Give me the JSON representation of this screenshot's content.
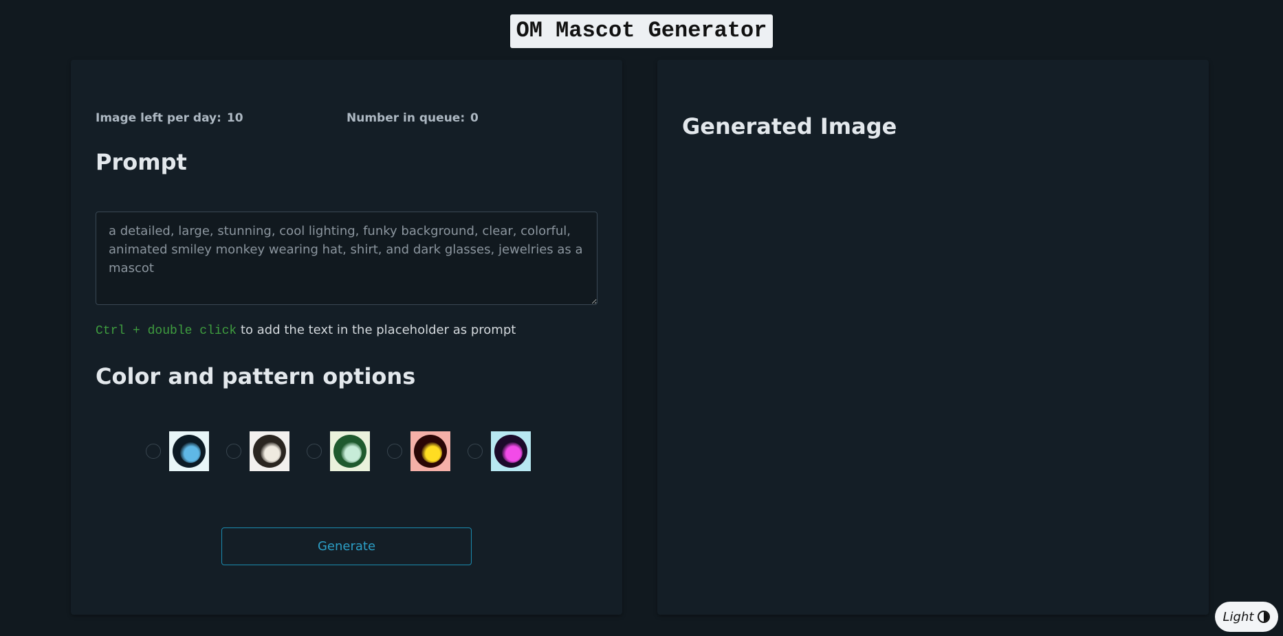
{
  "header": {
    "title": "OM Mascot Generator"
  },
  "left_panel": {
    "stats": {
      "images_left_label": "Image left per day:",
      "images_left_value": "10",
      "queue_label": "Number in queue:",
      "queue_value": "0"
    },
    "prompt_heading": "Prompt",
    "prompt_input": {
      "value": "",
      "placeholder": "a detailed, large, stunning, cool lighting, funky background, clear, colorful, animated smiley monkey wearing hat, shirt, and dark glasses, jewelries as a mascot"
    },
    "hint": {
      "shortcut": "Ctrl + double click",
      "text": " to add the text in the placeholder as prompt"
    },
    "color_heading": "Color and pattern options",
    "color_options": [
      {
        "name": "option-1",
        "colors": [
          "#e8f6f8",
          "#0b1a24",
          "#5fb8e6"
        ]
      },
      {
        "name": "option-2",
        "colors": [
          "#f2f0ee",
          "#2a2520",
          "#efeae0"
        ]
      },
      {
        "name": "option-3",
        "colors": [
          "#eaf2dc",
          "#1f5a2e",
          "#c7ecd8"
        ]
      },
      {
        "name": "option-4",
        "colors": [
          "#f5b0a8",
          "#2a0606",
          "#ffdd22"
        ]
      },
      {
        "name": "option-5",
        "colors": [
          "#b8e8f2",
          "#1c0a2a",
          "#f24be8"
        ]
      }
    ],
    "generate_label": "Generate"
  },
  "right_panel": {
    "heading": "Generated Image"
  },
  "theme_toggle": {
    "label": "Light"
  },
  "accent_colors": {
    "background": "#11191f",
    "panel": "#141e26",
    "button_border": "#1b8cb0",
    "shortcut_green": "#3f9e3f"
  }
}
